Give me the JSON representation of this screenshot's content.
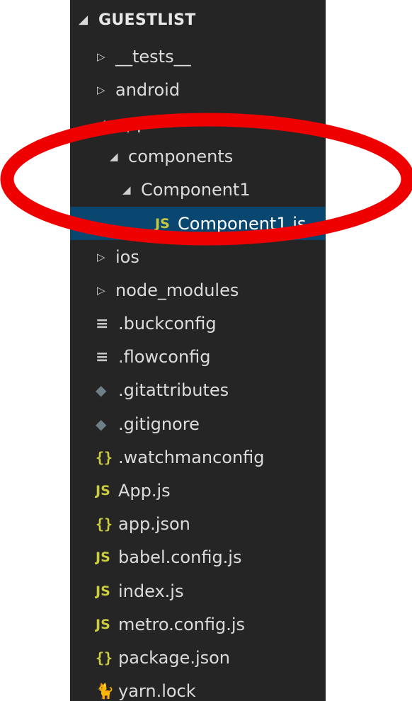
{
  "explorer": {
    "section_title": "GUESTLIST",
    "section_twist_icon": "chevron-down-icon",
    "items": [
      {
        "label": "__tests__",
        "kind": "folder",
        "state": "collapsed",
        "depth": 0
      },
      {
        "label": "android",
        "kind": "folder",
        "state": "collapsed",
        "depth": 0
      },
      {
        "label": "app",
        "kind": "folder",
        "state": "expanded",
        "depth": 0
      },
      {
        "label": "components",
        "kind": "folder",
        "state": "expanded",
        "depth": 1
      },
      {
        "label": "Component1",
        "kind": "folder",
        "state": "expanded",
        "depth": 2
      },
      {
        "label": "Component1.js",
        "kind": "file",
        "icon": "js-icon",
        "icon_text": "JS",
        "depth": 3,
        "selected": true
      },
      {
        "label": "ios",
        "kind": "folder",
        "state": "collapsed",
        "depth": 0
      },
      {
        "label": "node_modules",
        "kind": "folder",
        "state": "collapsed",
        "depth": 0
      },
      {
        "label": ".buckconfig",
        "kind": "file",
        "icon": "config-lines-icon",
        "icon_text": "≡",
        "depth": 0
      },
      {
        "label": ".flowconfig",
        "kind": "file",
        "icon": "config-lines-icon",
        "icon_text": "≡",
        "depth": 0
      },
      {
        "label": ".gitattributes",
        "kind": "file",
        "icon": "git-icon",
        "icon_text": "◆",
        "depth": 0
      },
      {
        "label": ".gitignore",
        "kind": "file",
        "icon": "git-icon",
        "icon_text": "◆",
        "depth": 0
      },
      {
        "label": ".watchmanconfig",
        "kind": "file",
        "icon": "json-braces-icon",
        "icon_text": "{}",
        "depth": 0
      },
      {
        "label": "App.js",
        "kind": "file",
        "icon": "js-icon",
        "icon_text": "JS",
        "depth": 0
      },
      {
        "label": "app.json",
        "kind": "file",
        "icon": "json-braces-icon",
        "icon_text": "{}",
        "depth": 0
      },
      {
        "label": "babel.config.js",
        "kind": "file",
        "icon": "js-icon",
        "icon_text": "JS",
        "depth": 0
      },
      {
        "label": "index.js",
        "kind": "file",
        "icon": "js-icon",
        "icon_text": "JS",
        "depth": 0
      },
      {
        "label": "metro.config.js",
        "kind": "file",
        "icon": "js-icon",
        "icon_text": "JS",
        "depth": 0
      },
      {
        "label": "package.json",
        "kind": "file",
        "icon": "json-braces-icon",
        "icon_text": "{}",
        "depth": 0
      },
      {
        "label": "yarn.lock",
        "kind": "file",
        "icon": "yarn-icon",
        "icon_text": "🐈",
        "depth": 0
      }
    ]
  },
  "colors": {
    "sidebar_bg": "#252526",
    "selection_bg": "#094771",
    "js_icon": "#cbcb41",
    "annotation_red": "#ee0000"
  },
  "annotation": {
    "shape": "red-ellipse",
    "highlights": "app/components/Component1/Component1.js"
  }
}
